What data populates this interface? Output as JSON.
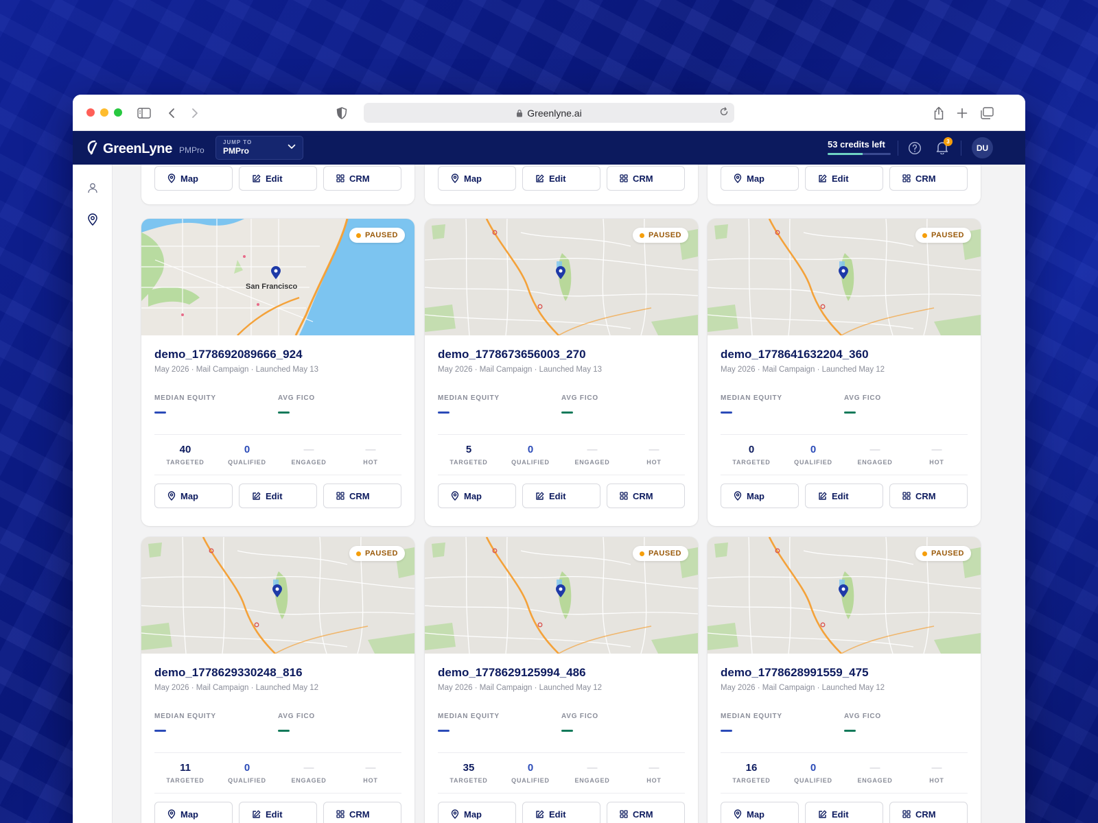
{
  "browser": {
    "url": "Greenlyne.ai"
  },
  "header": {
    "logo_name": "GreenLyne",
    "logo_sub": "PMPro",
    "jump_label": "JUMP TO",
    "jump_value": "PMPro",
    "credits_text": "53 credits left",
    "notification_count": "3",
    "avatar_initials": "DU"
  },
  "labels": {
    "median_equity": "MEDIAN EQUITY",
    "avg_fico": "AVG FICO",
    "targeted": "TARGETED",
    "qualified": "QUALIFIED",
    "engaged": "ENGAGED",
    "hot": "HOT",
    "map": "Map",
    "edit": "Edit",
    "crm": "CRM",
    "dash": "—"
  },
  "top_cards_partial": [
    {
      "map": "Map",
      "edit": "Edit",
      "crm": "CRM"
    },
    {
      "map": "Map",
      "edit": "Edit",
      "crm": "CRM"
    },
    {
      "map": "Map",
      "edit": "Edit",
      "crm": "CRM"
    }
  ],
  "campaigns": [
    {
      "name": "demo_1778692089666_924",
      "sub": "May 2026 · Mail Campaign · Launched May 13",
      "status": "PAUSED",
      "targeted": "40",
      "qualified": "0",
      "engaged": "—",
      "hot": "—",
      "map_style": "sf",
      "map_text": "San Francisco"
    },
    {
      "name": "demo_1778673656003_270",
      "sub": "May 2026 · Mail Campaign · Launched May 13",
      "status": "PAUSED",
      "targeted": "5",
      "qualified": "0",
      "engaged": "—",
      "hot": "—",
      "map_style": "sr"
    },
    {
      "name": "demo_1778641632204_360",
      "sub": "May 2026 · Mail Campaign · Launched May 12",
      "status": "PAUSED",
      "targeted": "0",
      "qualified": "0",
      "engaged": "—",
      "hot": "—",
      "map_style": "sr"
    },
    {
      "name": "demo_1778629330248_816",
      "sub": "May 2026 · Mail Campaign · Launched May 12",
      "status": "PAUSED",
      "targeted": "11",
      "qualified": "0",
      "engaged": "—",
      "hot": "—",
      "map_style": "sr"
    },
    {
      "name": "demo_1778629125994_486",
      "sub": "May 2026 · Mail Campaign · Launched May 12",
      "status": "PAUSED",
      "targeted": "35",
      "qualified": "0",
      "engaged": "—",
      "hot": "—",
      "map_style": "sr"
    },
    {
      "name": "demo_1778628991559_475",
      "sub": "May 2026 · Mail Campaign · Launched May 12",
      "status": "PAUSED",
      "targeted": "16",
      "qualified": "0",
      "engaged": "—",
      "hot": "—",
      "map_style": "sr"
    }
  ]
}
